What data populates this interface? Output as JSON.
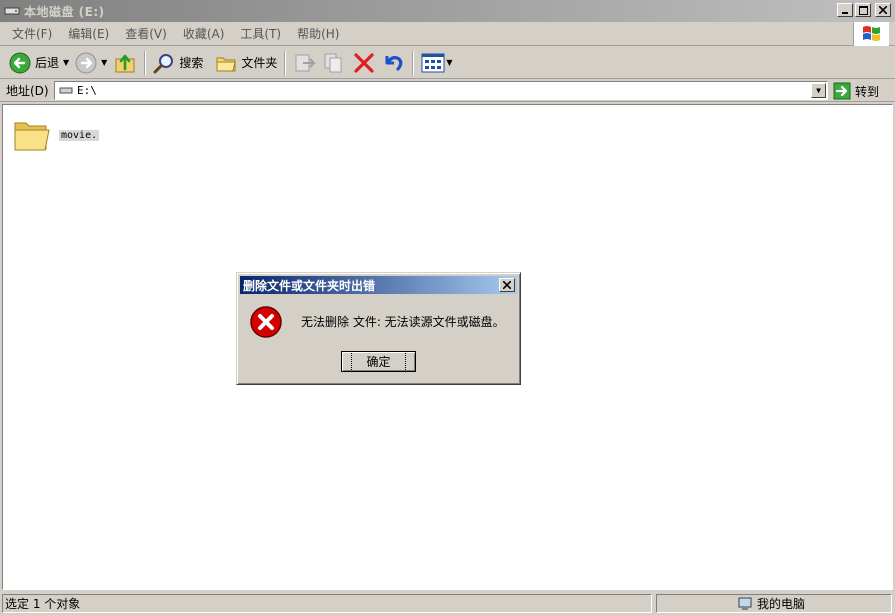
{
  "window": {
    "title": "本地磁盘 (E:)"
  },
  "menu": {
    "items": [
      "文件(F)",
      "编辑(E)",
      "查看(V)",
      "收藏(A)",
      "工具(T)",
      "帮助(H)"
    ]
  },
  "toolbar": {
    "back_label": "后退",
    "search_label": "搜索",
    "folders_label": "文件夹"
  },
  "address": {
    "label": "地址(D)",
    "value": "E:\\",
    "go_label": "转到"
  },
  "files": [
    {
      "name": "movie.",
      "icon": "folder-icon"
    }
  ],
  "status": {
    "left": "选定 1 个对象",
    "right": "我的电脑"
  },
  "dialog": {
    "title": "删除文件或文件夹时出错",
    "message": "无法删除 文件: 无法读源文件或磁盘。",
    "ok_label": "确定"
  },
  "colors": {
    "titlebar_inactive": "#808080",
    "dialog_title": "#0a246a",
    "error_red": "#d40000",
    "face": "#d4d0c8"
  }
}
